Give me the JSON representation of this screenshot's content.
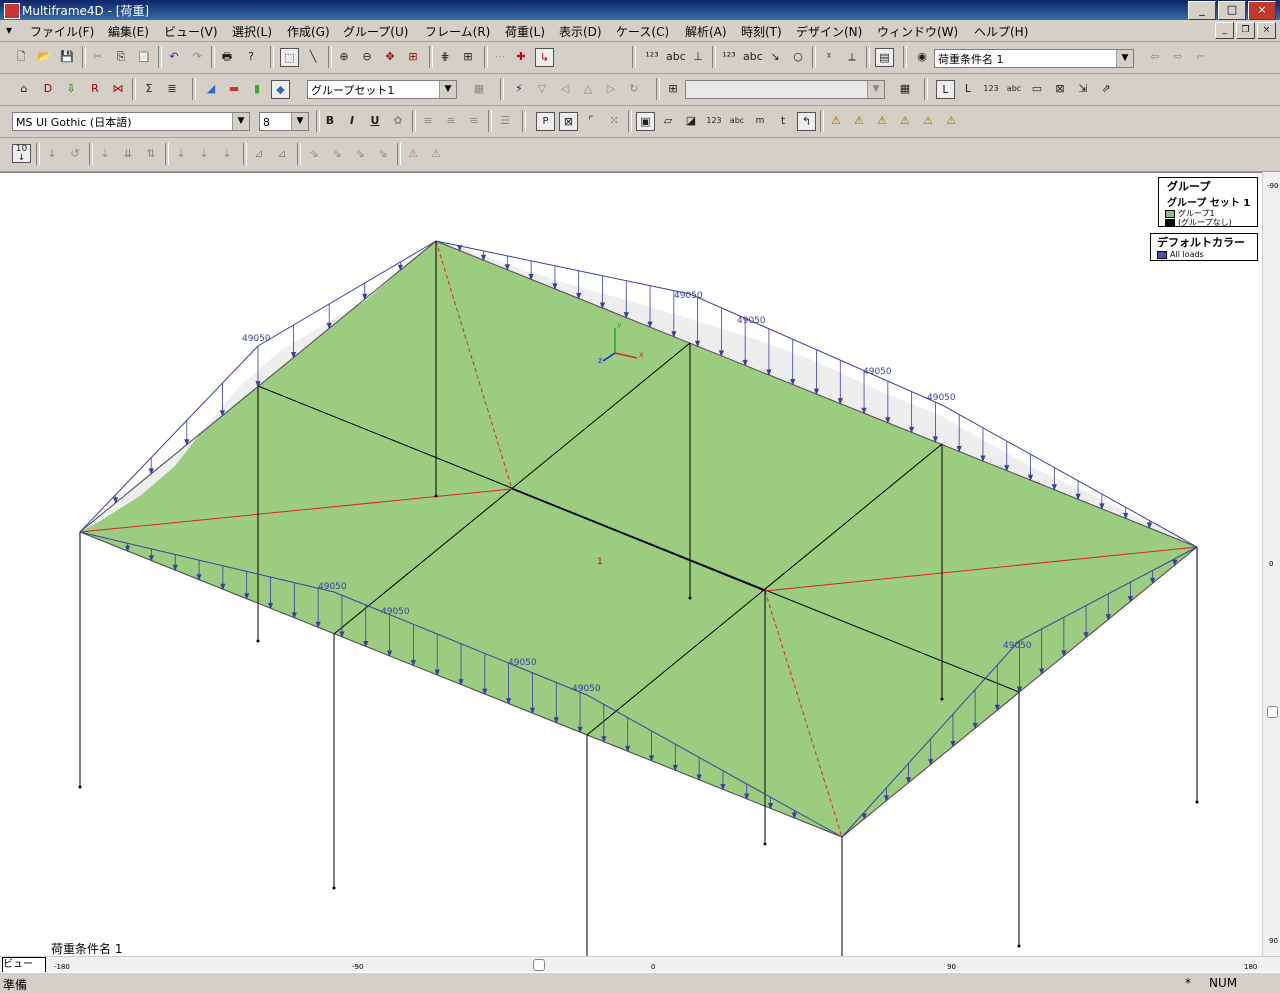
{
  "window": {
    "title": "Multiframe4D - [荷重]"
  },
  "menu": [
    "ファイル(F)",
    "編集(E)",
    "ビュー(V)",
    "選択(L)",
    "作成(G)",
    "グループ(U)",
    "フレーム(R)",
    "荷重(L)",
    "表示(D)",
    "ケース(C)",
    "解析(A)",
    "時刻(T)",
    "デザイン(N)",
    "ウィンドウ(W)",
    "ヘルプ(H)"
  ],
  "toolbar": {
    "load_case_select": "荷重条件名 1",
    "group_set_select": "グループセット1",
    "font_family": "MS UI Gothic (日本語)",
    "font_size": "8",
    "bold": "B",
    "italic": "I",
    "underline": "U",
    "scale_button": "10"
  },
  "legend": {
    "group_title": "グループ",
    "group_set_label": "グループ セット 1",
    "items": [
      {
        "label": "グループ1",
        "color": "#8fbf77"
      },
      {
        "label": "(グループなし)",
        "color": "#000000"
      }
    ],
    "default_color_title": "デフォルトカラー",
    "default_items": [
      {
        "label": "All loads",
        "color": "#4b4fb0"
      }
    ]
  },
  "model": {
    "load_value": "49050",
    "panel_label": "1",
    "axis_x": "x",
    "axis_y": "y",
    "axis_z": "z"
  },
  "view": {
    "case_label": "荷重条件名 1",
    "view_tab": "ビュー"
  },
  "ruler": {
    "h_ticks": [
      "-180",
      "-90",
      "0",
      "90",
      "180"
    ],
    "v_ticks": [
      "-90",
      "0",
      "90"
    ]
  },
  "status": {
    "left": "準備",
    "mark": "*",
    "num": "NUM"
  },
  "colors": {
    "slab": "#9ccc80",
    "load_line": "#3a3fa0",
    "diag": "#d22222"
  }
}
